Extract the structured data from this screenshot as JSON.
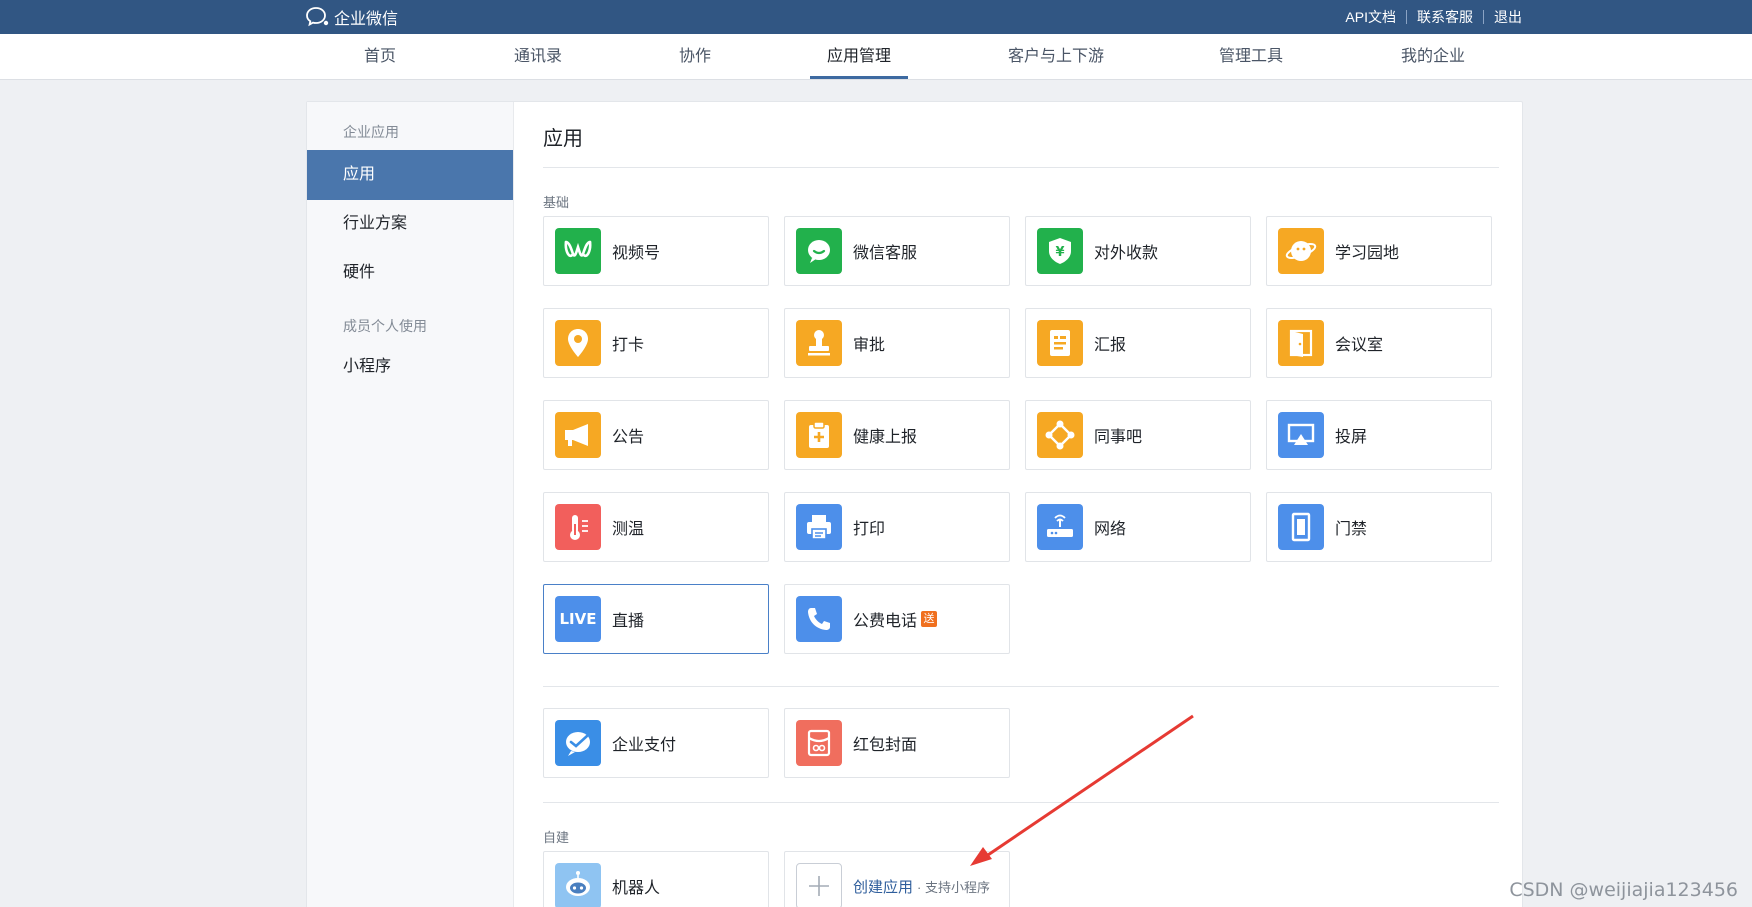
{
  "topbar": {
    "logo_text": "企业微信",
    "links": [
      "API文档",
      "联系客服",
      "退出"
    ]
  },
  "nav": {
    "items": [
      "首页",
      "通讯录",
      "协作",
      "应用管理",
      "客户与上下游",
      "管理工具",
      "我的企业"
    ],
    "active": "应用管理"
  },
  "sidebar": {
    "group1": "企业应用",
    "items1": [
      "应用",
      "行业方案",
      "硬件"
    ],
    "active": "应用",
    "group2": "成员个人使用",
    "items2": [
      "小程序"
    ]
  },
  "main": {
    "title": "应用",
    "section_basic": "基础",
    "basic_apps": [
      {
        "name": "视频号",
        "icon": "channels-icon",
        "color": "#22b14c"
      },
      {
        "name": "微信客服",
        "icon": "wechat-service-icon",
        "color": "#22b14c"
      },
      {
        "name": "对外收款",
        "icon": "payment-shield-icon",
        "color": "#22b14c"
      },
      {
        "name": "学习园地",
        "icon": "learning-planet-icon",
        "color": "#f6a823"
      },
      {
        "name": "打卡",
        "icon": "location-pin-icon",
        "color": "#f6a823"
      },
      {
        "name": "审批",
        "icon": "stamp-icon",
        "color": "#f6a823"
      },
      {
        "name": "汇报",
        "icon": "report-doc-icon",
        "color": "#f6a823"
      },
      {
        "name": "会议室",
        "icon": "door-icon",
        "color": "#f6a823"
      },
      {
        "name": "公告",
        "icon": "megaphone-icon",
        "color": "#f6a823"
      },
      {
        "name": "健康上报",
        "icon": "health-clipboard-icon",
        "color": "#f6a823"
      },
      {
        "name": "同事吧",
        "icon": "network-nodes-icon",
        "color": "#f6a823"
      },
      {
        "name": "投屏",
        "icon": "screen-cast-icon",
        "color": "#4d8fea"
      },
      {
        "name": "测温",
        "icon": "thermometer-icon",
        "color": "#f25f5c"
      },
      {
        "name": "打印",
        "icon": "printer-icon",
        "color": "#4d8fea"
      },
      {
        "name": "网络",
        "icon": "router-icon",
        "color": "#4d8fea"
      },
      {
        "name": "门禁",
        "icon": "access-door-icon",
        "color": "#4d8fea"
      },
      {
        "name": "直播",
        "icon": "live-icon",
        "color": "#4d8fea",
        "icon_text": "LIVE"
      },
      {
        "name": "公费电话",
        "icon": "phone-icon",
        "color": "#4d8fea",
        "badge": "送"
      }
    ],
    "extra_apps": [
      {
        "name": "企业支付",
        "icon": "enterprise-pay-icon",
        "color": "#3a8ee6"
      },
      {
        "name": "红包封面",
        "icon": "red-packet-icon",
        "color": "#f06e5e"
      }
    ],
    "section_custom": "自建",
    "custom_apps": [
      {
        "name": "机器人",
        "icon": "robot-icon",
        "color": "#8fc4f2"
      }
    ],
    "create": {
      "label": "创建应用",
      "sub": "· 支持小程序"
    }
  },
  "watermark": "CSDN @weijiajia123456",
  "colors": {
    "topbar": "#315683",
    "accent": "#4a76ac",
    "link": "#2f5e9c"
  }
}
